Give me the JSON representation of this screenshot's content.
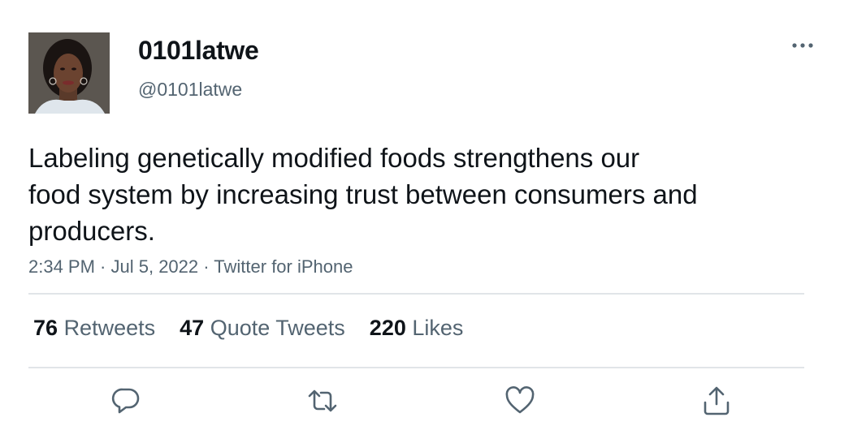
{
  "author": {
    "display_name": "0101latwe",
    "handle": "@0101latwe"
  },
  "tweet": {
    "text_lines": [
      "Labeling genetically modified foods strengthens our",
      "food system by increasing trust between consumers and",
      "producers."
    ],
    "time": "2:34 PM",
    "date": "Jul 5, 2022",
    "source": "Twitter for iPhone",
    "separator": " · "
  },
  "stats": {
    "retweets": {
      "count": "76",
      "label": "Retweets"
    },
    "quotes": {
      "count": "47",
      "label": "Quote Tweets"
    },
    "likes": {
      "count": "220",
      "label": "Likes"
    }
  },
  "icons": {
    "more": "more-horizontal-icon",
    "reply": "reply-icon",
    "retweet": "retweet-icon",
    "like": "heart-icon",
    "share": "share-icon"
  },
  "colors": {
    "text_primary": "#0f1419",
    "text_secondary": "#536471",
    "divider": "#e1e5e8"
  }
}
